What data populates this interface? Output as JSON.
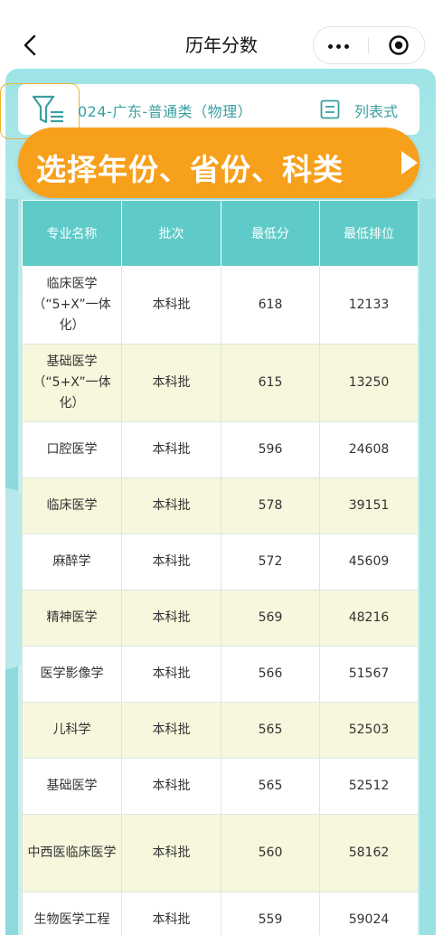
{
  "header": {
    "title": "历年分数"
  },
  "filter": {
    "text": "024-广东-普通类（物理）",
    "list_label": "列表式"
  },
  "banner": {
    "text": "选择年份、省份、科类"
  },
  "table": {
    "columns": [
      "专业名称",
      "批次",
      "最低分",
      "最低排位"
    ],
    "rows": [
      {
        "major": "临床医学（“5+X”一体化）",
        "batch": "本科批",
        "min_score": "618",
        "min_rank": "12133"
      },
      {
        "major": "基础医学（“5+X”一体化）",
        "batch": "本科批",
        "min_score": "615",
        "min_rank": "13250"
      },
      {
        "major": "口腔医学",
        "batch": "本科批",
        "min_score": "596",
        "min_rank": "24608"
      },
      {
        "major": "临床医学",
        "batch": "本科批",
        "min_score": "578",
        "min_rank": "39151"
      },
      {
        "major": "麻醉学",
        "batch": "本科批",
        "min_score": "572",
        "min_rank": "45609"
      },
      {
        "major": "精神医学",
        "batch": "本科批",
        "min_score": "569",
        "min_rank": "48216"
      },
      {
        "major": "医学影像学",
        "batch": "本科批",
        "min_score": "566",
        "min_rank": "51567"
      },
      {
        "major": "儿科学",
        "batch": "本科批",
        "min_score": "565",
        "min_rank": "52503"
      },
      {
        "major": "基础医学",
        "batch": "本科批",
        "min_score": "565",
        "min_rank": "52512"
      },
      {
        "major": "中西医临床医学",
        "batch": "本科批",
        "min_score": "560",
        "min_rank": "58162"
      },
      {
        "major": "生物医学工程",
        "batch": "本科批",
        "min_score": "559",
        "min_rank": "59024"
      }
    ]
  },
  "colors": {
    "header_bg": "#5fcbc8",
    "banner_bg": "#f7a01c",
    "accent_text": "#3aa0a0",
    "even_row_bg": "#f6f7dc"
  }
}
